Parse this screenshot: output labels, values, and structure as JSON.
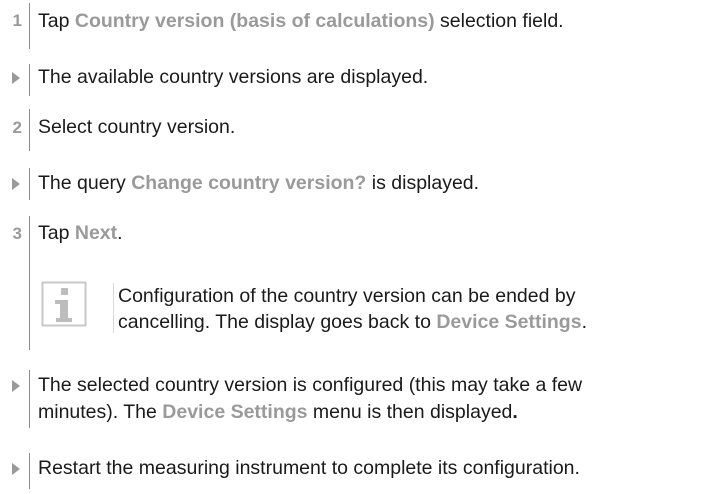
{
  "steps": [
    {
      "marker": "1",
      "pre": "Tap ",
      "hl": "Country version (basis of calculations)",
      "post": " selection field."
    },
    {
      "marker_icon": "result-arrow-icon",
      "text": "The available country versions are displayed."
    },
    {
      "marker": "2",
      "text": "Select country version."
    },
    {
      "marker_icon": "result-arrow-icon",
      "pre": "The query ",
      "hl": "Change country version?",
      "post": " is displayed."
    },
    {
      "marker": "3",
      "pre": "Tap ",
      "hl": "Next",
      "post": "."
    },
    {
      "marker_icon": "result-arrow-icon",
      "line1": "The selected country version is configured (this may take a few",
      "line2_pre": "minutes). The ",
      "line2_hl": "Device Settings",
      "line2_post": " menu is then displayed",
      "line2_end": "."
    },
    {
      "marker_icon": "result-arrow-icon",
      "text": "Restart the measuring instrument to complete its configuration."
    }
  ],
  "note": {
    "icon": "info-icon",
    "line1": "Configuration of the country version can be ended by",
    "line2_pre": "cancelling. The display goes back to ",
    "line2_hl": "Device Settings",
    "line2_post": "."
  }
}
